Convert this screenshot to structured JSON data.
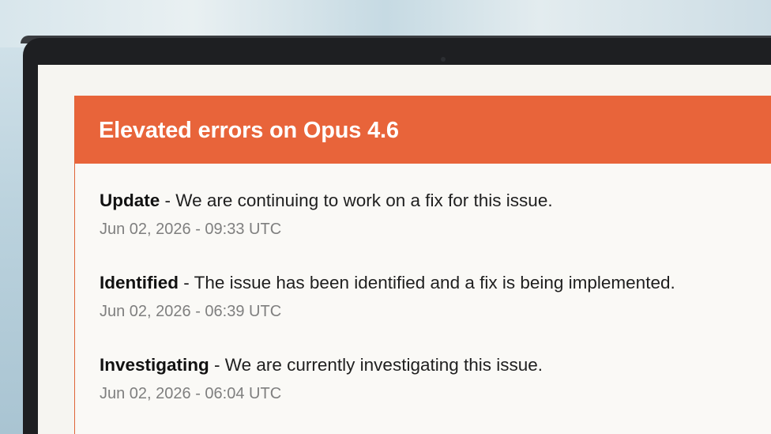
{
  "incident": {
    "title": "Elevated errors on Opus 4.6",
    "updates": [
      {
        "status": "Update",
        "separator": " - ",
        "message": "We are continuing to work on a fix for this issue.",
        "timestamp": "Jun 02, 2026 - 09:33 UTC"
      },
      {
        "status": "Identified",
        "separator": " - ",
        "message": "The issue has been identified and a fix is being implemented.",
        "timestamp": "Jun 02, 2026 - 06:39 UTC"
      },
      {
        "status": "Investigating",
        "separator": " - ",
        "message": "We are currently investigating this issue.",
        "timestamp": "Jun 02, 2026 - 06:04 UTC"
      }
    ]
  },
  "colors": {
    "header_bg": "#e8643a",
    "header_text": "#ffffff",
    "status_text": "#111111",
    "timestamp_text": "#7f7f7f"
  }
}
